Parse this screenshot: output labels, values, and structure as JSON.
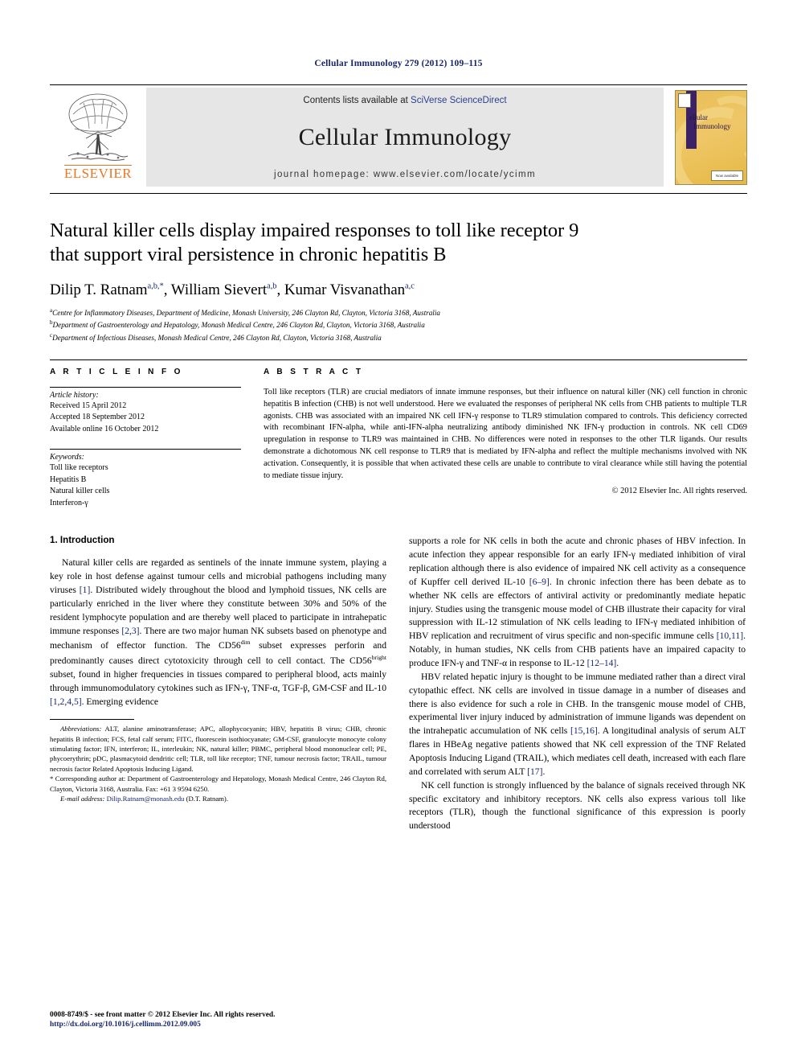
{
  "running_head": "Cellular Immunology 279 (2012) 109–115",
  "masthead": {
    "publisher_name": "ELSEVIER",
    "contents_prefix": "Contents lists available at ",
    "contents_link": "SciVerse ScienceDirect",
    "journal_title": "Cellular Immunology",
    "homepage": "journal homepage: www.elsevier.com/locate/ycimm",
    "cover": {
      "line1": "ellular",
      "line2": "Immunology",
      "footer_badge": "Now available"
    }
  },
  "article": {
    "title_line1": "Natural killer cells display impaired responses to toll like receptor 9",
    "title_line2": "that support viral persistence in chronic hepatitis B",
    "authors": [
      {
        "name": "Dilip T. Ratnam",
        "marks": "a,b,*"
      },
      {
        "name": "William Sievert",
        "marks": "a,b"
      },
      {
        "name": "Kumar Visvanathan",
        "marks": "a,c"
      }
    ],
    "affiliations": [
      {
        "mark": "a",
        "text": "Centre for Inflammatory Diseases, Department of Medicine, Monash University, 246 Clayton Rd, Clayton, Victoria 3168, Australia"
      },
      {
        "mark": "b",
        "text": "Department of Gastroenterology and Hepatology, Monash Medical Centre, 246 Clayton Rd, Clayton, Victoria 3168, Australia"
      },
      {
        "mark": "c",
        "text": "Department of Infectious Diseases, Monash Medical Centre, 246 Clayton Rd, Clayton, Victoria 3168, Australia"
      }
    ]
  },
  "article_info": {
    "heading": "A R T I C L E  I N F O",
    "history_label": "Article history:",
    "history": [
      "Received 15 April 2012",
      "Accepted 18 September 2012",
      "Available online 16 October 2012"
    ],
    "keywords_label": "Keywords:",
    "keywords": [
      "Toll like receptors",
      "Hepatitis B",
      "Natural killer cells",
      "Interferon-γ"
    ]
  },
  "abstract": {
    "heading": "A B S T R A C T",
    "text": "Toll like receptors (TLR) are crucial mediators of innate immune responses, but their influence on natural killer (NK) cell function in chronic hepatitis B infection (CHB) is not well understood. Here we evaluated the responses of peripheral NK cells from CHB patients to multiple TLR agonists. CHB was associated with an impaired NK cell IFN-γ response to TLR9 stimulation compared to controls. This deficiency corrected with recombinant IFN-alpha, while anti-IFN-alpha neutralizing antibody diminished NK IFN-γ production in controls. NK cell CD69 upregulation in response to TLR9 was maintained in CHB. No differences were noted in responses to the other TLR ligands. Our results demonstrate a dichotomous NK cell response to TLR9 that is mediated by IFN-alpha and reflect the multiple mechanisms involved with NK activation. Consequently, it is possible that when activated these cells are unable to contribute to viral clearance while still having the potential to mediate tissue injury.",
    "copyright": "© 2012 Elsevier Inc. All rights reserved."
  },
  "body": {
    "section_title": "1. Introduction",
    "left_paragraph_1_a": "Natural killer cells are regarded as sentinels of the innate immune system, playing a key role in host defense against tumour cells and microbial pathogens including many viruses ",
    "left_ref_1": "[1]",
    "left_paragraph_1_b": ". Distributed widely throughout the blood and lymphoid tissues, NK cells are particularly enriched in the liver where they constitute between 30% and 50% of the resident lymphocyte population and are thereby well placed to participate in intrahepatic immune responses ",
    "left_ref_2": "[2,3]",
    "left_paragraph_1_c": ". There are two major human NK subsets based on phenotype and mechanism of effector function. The CD56",
    "left_sup_dim": "dim",
    "left_paragraph_1_d": " subset expresses perforin and predominantly causes direct cytotoxicity through cell to cell contact. The CD56",
    "left_sup_bright": "bright",
    "left_paragraph_1_e": " subset, found in higher frequencies in tissues compared to peripheral blood, acts mainly through immunomodulatory cytokines such as IFN-γ, TNF-α, TGF-β, GM-CSF and IL-10 ",
    "left_ref_3": "[1,2,4,5]",
    "left_paragraph_1_f": ". Emerging evidence",
    "right_paragraph_1_a": "supports a role for NK cells in both the acute and chronic phases of HBV infection. In acute infection they appear responsible for an early IFN-γ mediated inhibition of viral replication although there is also evidence of impaired NK cell activity as a consequence of Kupffer cell derived IL-10 ",
    "right_ref_1": "[6–9]",
    "right_paragraph_1_b": ". In chronic infection there has been debate as to whether NK cells are effectors of antiviral activity or predominantly mediate hepatic injury. Studies using the transgenic mouse model of CHB illustrate their capacity for viral suppression with IL-12 stimulation of NK cells leading to IFN-γ mediated inhibition of HBV replication and recruitment of virus specific and non-specific immune cells ",
    "right_ref_2": "[10,11]",
    "right_paragraph_1_c": ". Notably, in human studies, NK cells from CHB patients have an impaired capacity to produce IFN-γ and TNF-α in response to IL-12 ",
    "right_ref_3": "[12–14]",
    "right_paragraph_1_d": ".",
    "right_paragraph_2_a": "HBV related hepatic injury is thought to be immune mediated rather than a direct viral cytopathic effect. NK cells are involved in tissue damage in a number of diseases and there is also evidence for such a role in CHB. In the transgenic mouse model of CHB, experimental liver injury induced by administration of immune ligands was dependent on the intrahepatic accumulation of NK cells ",
    "right_ref_4": "[15,16]",
    "right_paragraph_2_b": ". A longitudinal analysis of serum ALT flares in HBeAg negative patients showed that NK cell expression of the TNF Related Apoptosis Inducing Ligand (TRAIL), which mediates cell death, increased with each flare and correlated with serum ALT ",
    "right_ref_5": "[17]",
    "right_paragraph_2_c": ".",
    "right_paragraph_3": "NK cell function is strongly influenced by the balance of signals received through NK specific excitatory and inhibitory receptors. NK cells also express various toll like receptors (TLR), though the functional significance of this expression is poorly understood"
  },
  "footnotes": {
    "abbrev_label": "Abbreviations:",
    "abbrev_text": " ALT, alanine aminotransferase; APC, allophycocyanin; HBV, hepatitis B virus; CHB, chronic hepatitis B infection; FCS, fetal calf serum; FITC, fluorescein isothiocyanate; GM-CSF, granulocyte monocyte colony stimulating factor; IFN, interferon; IL, interleukin; NK, natural killer; PBMC, peripheral blood mononuclear cell; PE, phycoerythrin; pDC, plasmacytoid dendritic cell; TLR, toll like receptor; TNF, tumour necrosis factor; TRAIL, tumour necrosis factor Related Apoptosis Inducing Ligand.",
    "corresponding": "* Corresponding author at: Department of Gastroenterology and Hepatology, Monash Medical Centre, 246 Clayton Rd, Clayton, Victoria 3168, Australia. Fax: +61 3 9594 6250.",
    "email_label": "E-mail address:",
    "email": "Dilip.Ratnam@monash.edu",
    "email_suffix": " (D.T. Ratnam)."
  },
  "page_footer": {
    "issn": "0008-8749/$ - see front matter © 2012 Elsevier Inc. All rights reserved.",
    "doi": "http://dx.doi.org/10.1016/j.cellimm.2012.09.005"
  },
  "colors": {
    "link_blue": "#17256b",
    "elsevier_orange": "#e87722",
    "masthead_gray": "#e6e6e6",
    "cover_gold": "#e8bd55",
    "cover_purple": "#3b2266"
  }
}
